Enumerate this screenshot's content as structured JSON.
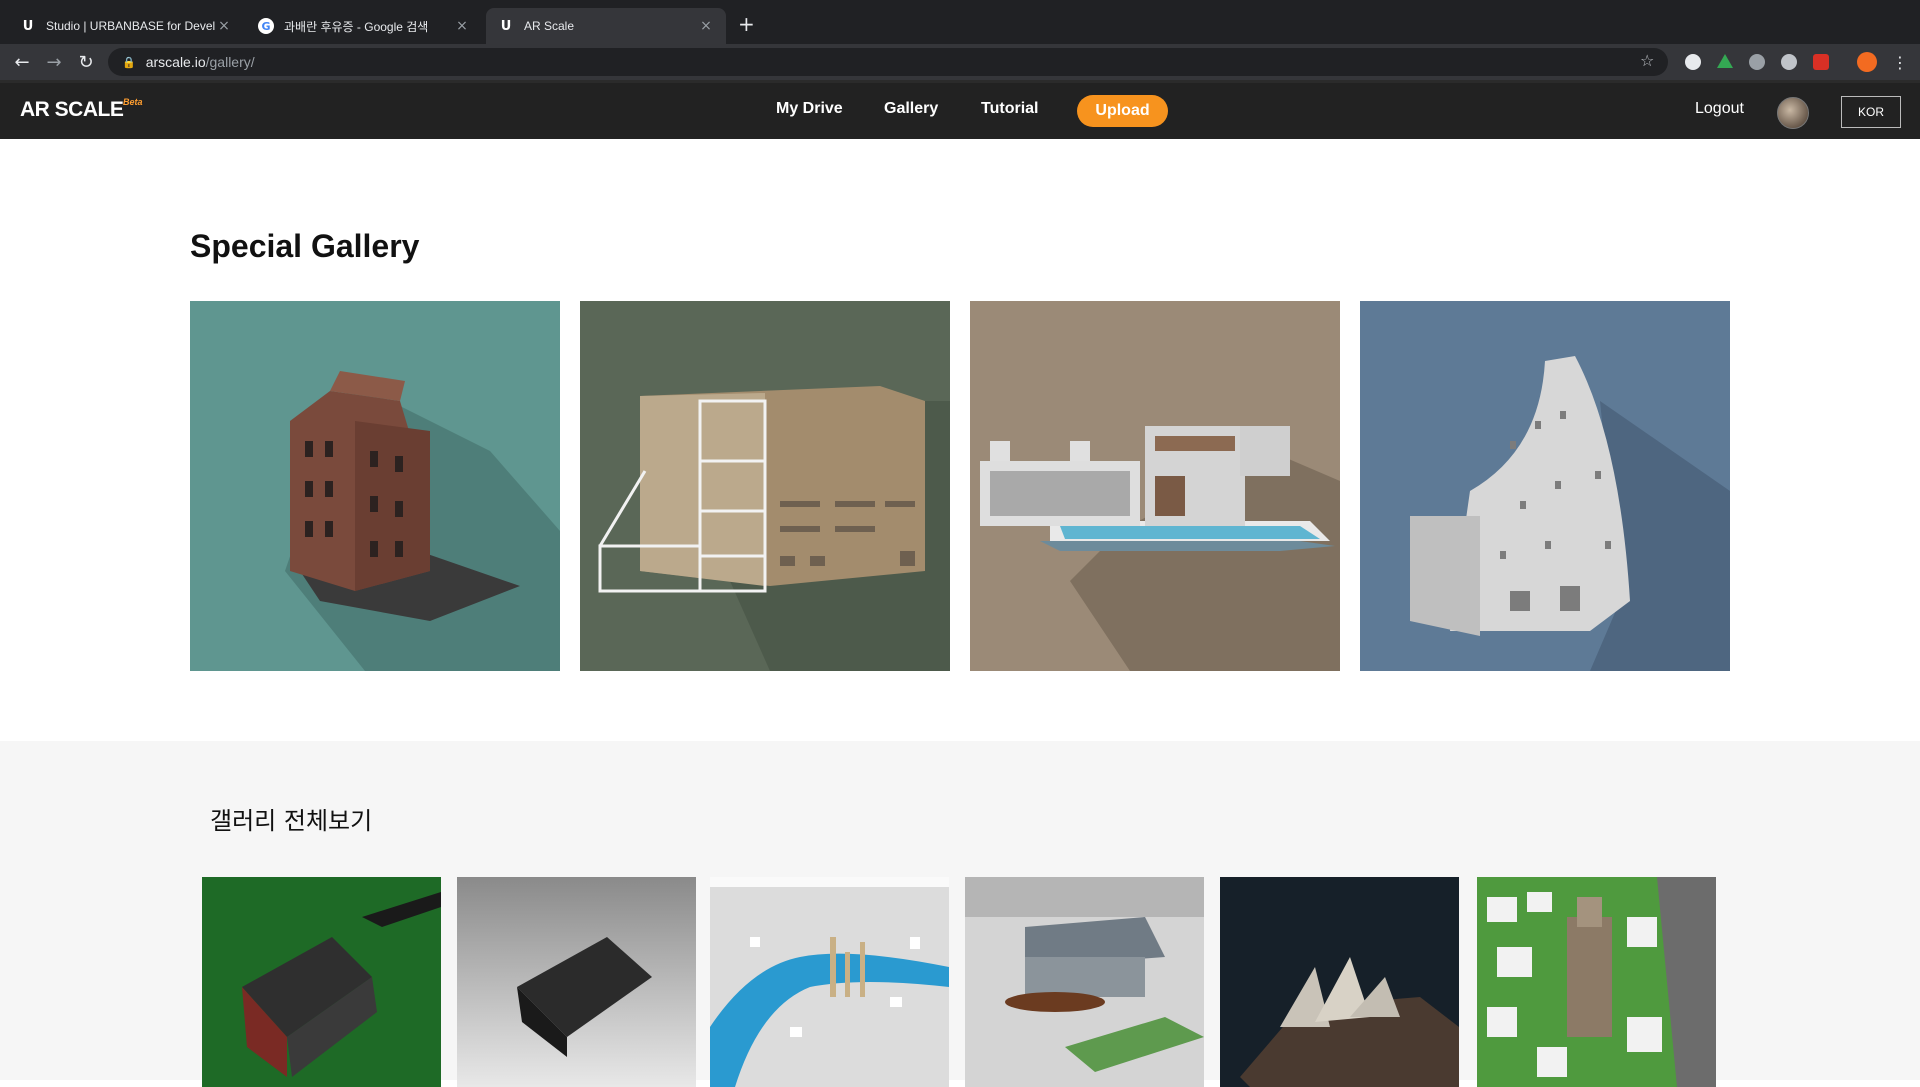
{
  "browser": {
    "tabs": [
      {
        "icon": "U",
        "title": "Studio | URBANBASE for Devel"
      },
      {
        "icon": "G",
        "title": "과배란 후유증 - Google 검색"
      },
      {
        "icon": "U",
        "title": "AR Scale"
      }
    ],
    "url_host": "arscale.io",
    "url_path": "/gallery/"
  },
  "header": {
    "logo": "AR SCALE",
    "logo_badge": "Beta",
    "nav": [
      "My Drive",
      "Gallery",
      "Tutorial"
    ],
    "upload": "Upload",
    "logout": "Logout",
    "lang": "KOR"
  },
  "special": {
    "title": "Special Gallery",
    "bg_colors": [
      "#5f9690",
      "#5a6757",
      "#9b8a77",
      "#5e7a96"
    ]
  },
  "all": {
    "title": "갤러리 전체보기"
  },
  "colors": {
    "accent": "#f7931e",
    "header_bg": "#222222"
  }
}
